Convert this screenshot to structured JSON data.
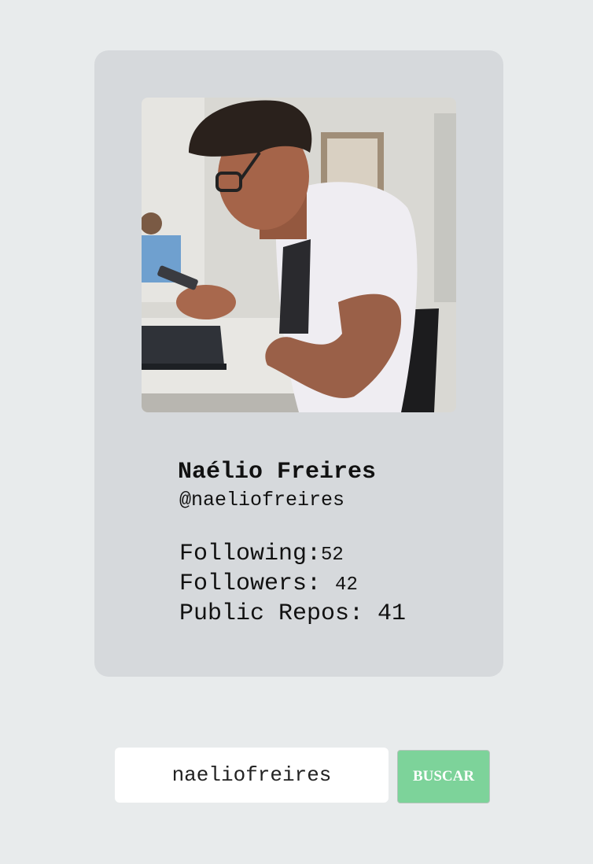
{
  "profile": {
    "avatar_alt": "Naélio Freires",
    "name": "Naélio Freires",
    "handle": "@naeliofreires",
    "following_label": "Following:",
    "following": "52",
    "followers_label": "Followers: ",
    "followers": "42",
    "repos_label": "Public Repos: ",
    "repos": "41"
  },
  "search": {
    "value": "naeliofreires",
    "button_label": "BUSCAR"
  },
  "colors": {
    "background": "#e8ebec",
    "card": "#d6d9dc",
    "button": "#7dd39a"
  }
}
